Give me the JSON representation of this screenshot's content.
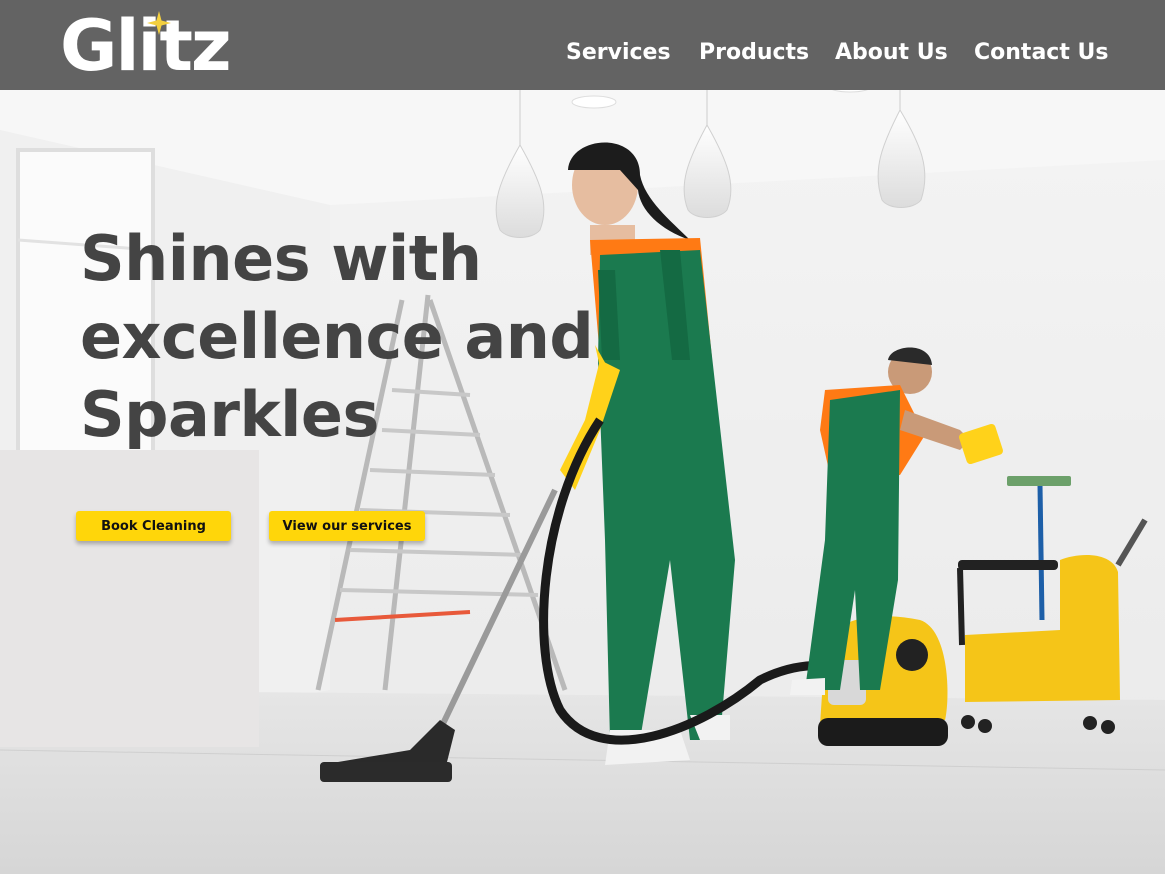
{
  "brand": {
    "name": "Glitz",
    "sparkle_color": "#f4d03f"
  },
  "nav": {
    "items": [
      {
        "label": "Services"
      },
      {
        "label": "Products"
      },
      {
        "label": "About Us"
      },
      {
        "label": "Contact Us"
      }
    ]
  },
  "hero": {
    "headline_lines": [
      "Shines with",
      "excellence and",
      "Sparkles"
    ],
    "image_description_icon": "cleaning-scene-image",
    "buttons": {
      "book_label": "Book Cleaning",
      "services_label": "View our services"
    }
  },
  "colors": {
    "header_bg": "#636363",
    "accent": "#ffd60a",
    "headline": "#444444",
    "panel": "#e7e5e5"
  }
}
